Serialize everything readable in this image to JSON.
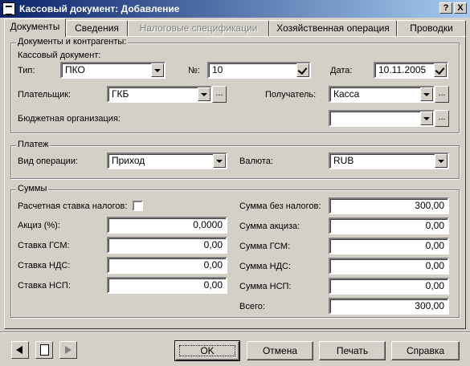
{
  "window": {
    "title": "Кассовый документ: Добавление",
    "help_button": "?",
    "close_button": "X"
  },
  "tabs": [
    {
      "label": "Документы"
    },
    {
      "label": "Сведения"
    },
    {
      "label": "Налоговые спецификации"
    },
    {
      "label": "Хозяйственная операция"
    },
    {
      "label": "Проводки"
    }
  ],
  "documents_group": {
    "title": "Документы и контрагенты:",
    "subtitle": "Кассовый документ:",
    "type_label": "Тип:",
    "type_value": "ПКО",
    "number_label": "№:",
    "number_value": "10",
    "date_label": "Дата:",
    "date_value": "10.11.2005",
    "payer_label": "Плательщик:",
    "payer_value": "ГКБ",
    "receiver_label": "Получатель:",
    "receiver_value": "Касса",
    "budget_label": "Бюджетная организация:",
    "budget_value": "",
    "ellipsis": "..."
  },
  "payment_group": {
    "title": "Платеж",
    "operation_label": "Вид операции:",
    "operation_value": "Приход",
    "currency_label": "Валюта:",
    "currency_value": "RUB"
  },
  "sums_group": {
    "title": "Суммы",
    "calc_tax_label": "Расчетная ставка налогов:",
    "excise_label": "Акциз (%):",
    "excise_value": "0,0000",
    "gsm_rate_label": "Ставка ГСМ:",
    "gsm_rate_value": "0,00",
    "nds_rate_label": "Ставка НДС:",
    "nds_rate_value": "0,00",
    "nsp_rate_label": "Ставка НСП:",
    "nsp_rate_value": "0,00",
    "sum_no_tax_label": "Сумма без налогов:",
    "sum_no_tax_value": "300,00",
    "sum_excise_label": "Сумма акциза:",
    "sum_excise_value": "0,00",
    "sum_gsm_label": "Сумма ГСМ:",
    "sum_gsm_value": "0,00",
    "sum_nds_label": "Сумма НДС:",
    "sum_nds_value": "0,00",
    "sum_nsp_label": "Сумма НСП:",
    "sum_nsp_value": "0,00",
    "total_label": "Всего:",
    "total_value": "300,00"
  },
  "buttons": {
    "ok": "OK",
    "cancel": "Отмена",
    "print": "Печать",
    "help": "Справка"
  }
}
